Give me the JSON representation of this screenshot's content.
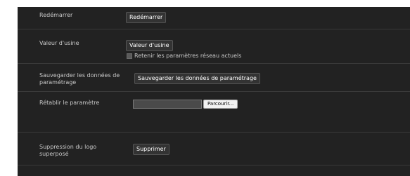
{
  "restart": {
    "label": "Redémarrer",
    "button_label": "Redémarrer"
  },
  "factory_default": {
    "label": "Valeur d'usine",
    "button_label": "Valeur d'usine",
    "checkbox_label": "Retenir les paramètres réseau actuels",
    "checkbox_checked": false
  },
  "save_settings": {
    "label_line1": "Sauvegarder les données de",
    "label_line2": "paramétrage",
    "button_label": "Sauvegarder les données de paramétrage"
  },
  "restore_settings": {
    "label": "Rétablir le paramètre",
    "file_value": "",
    "browse_label": "Parcourir..."
  },
  "delete_logo": {
    "label_line1": "Suppression du logo",
    "label_line2": "superposé",
    "button_label": "Supprimer"
  },
  "colors": {
    "panel_background": "#222222",
    "divider": "#3a3a3a",
    "label_text": "#c9c9c9",
    "button_background": "#333333"
  }
}
